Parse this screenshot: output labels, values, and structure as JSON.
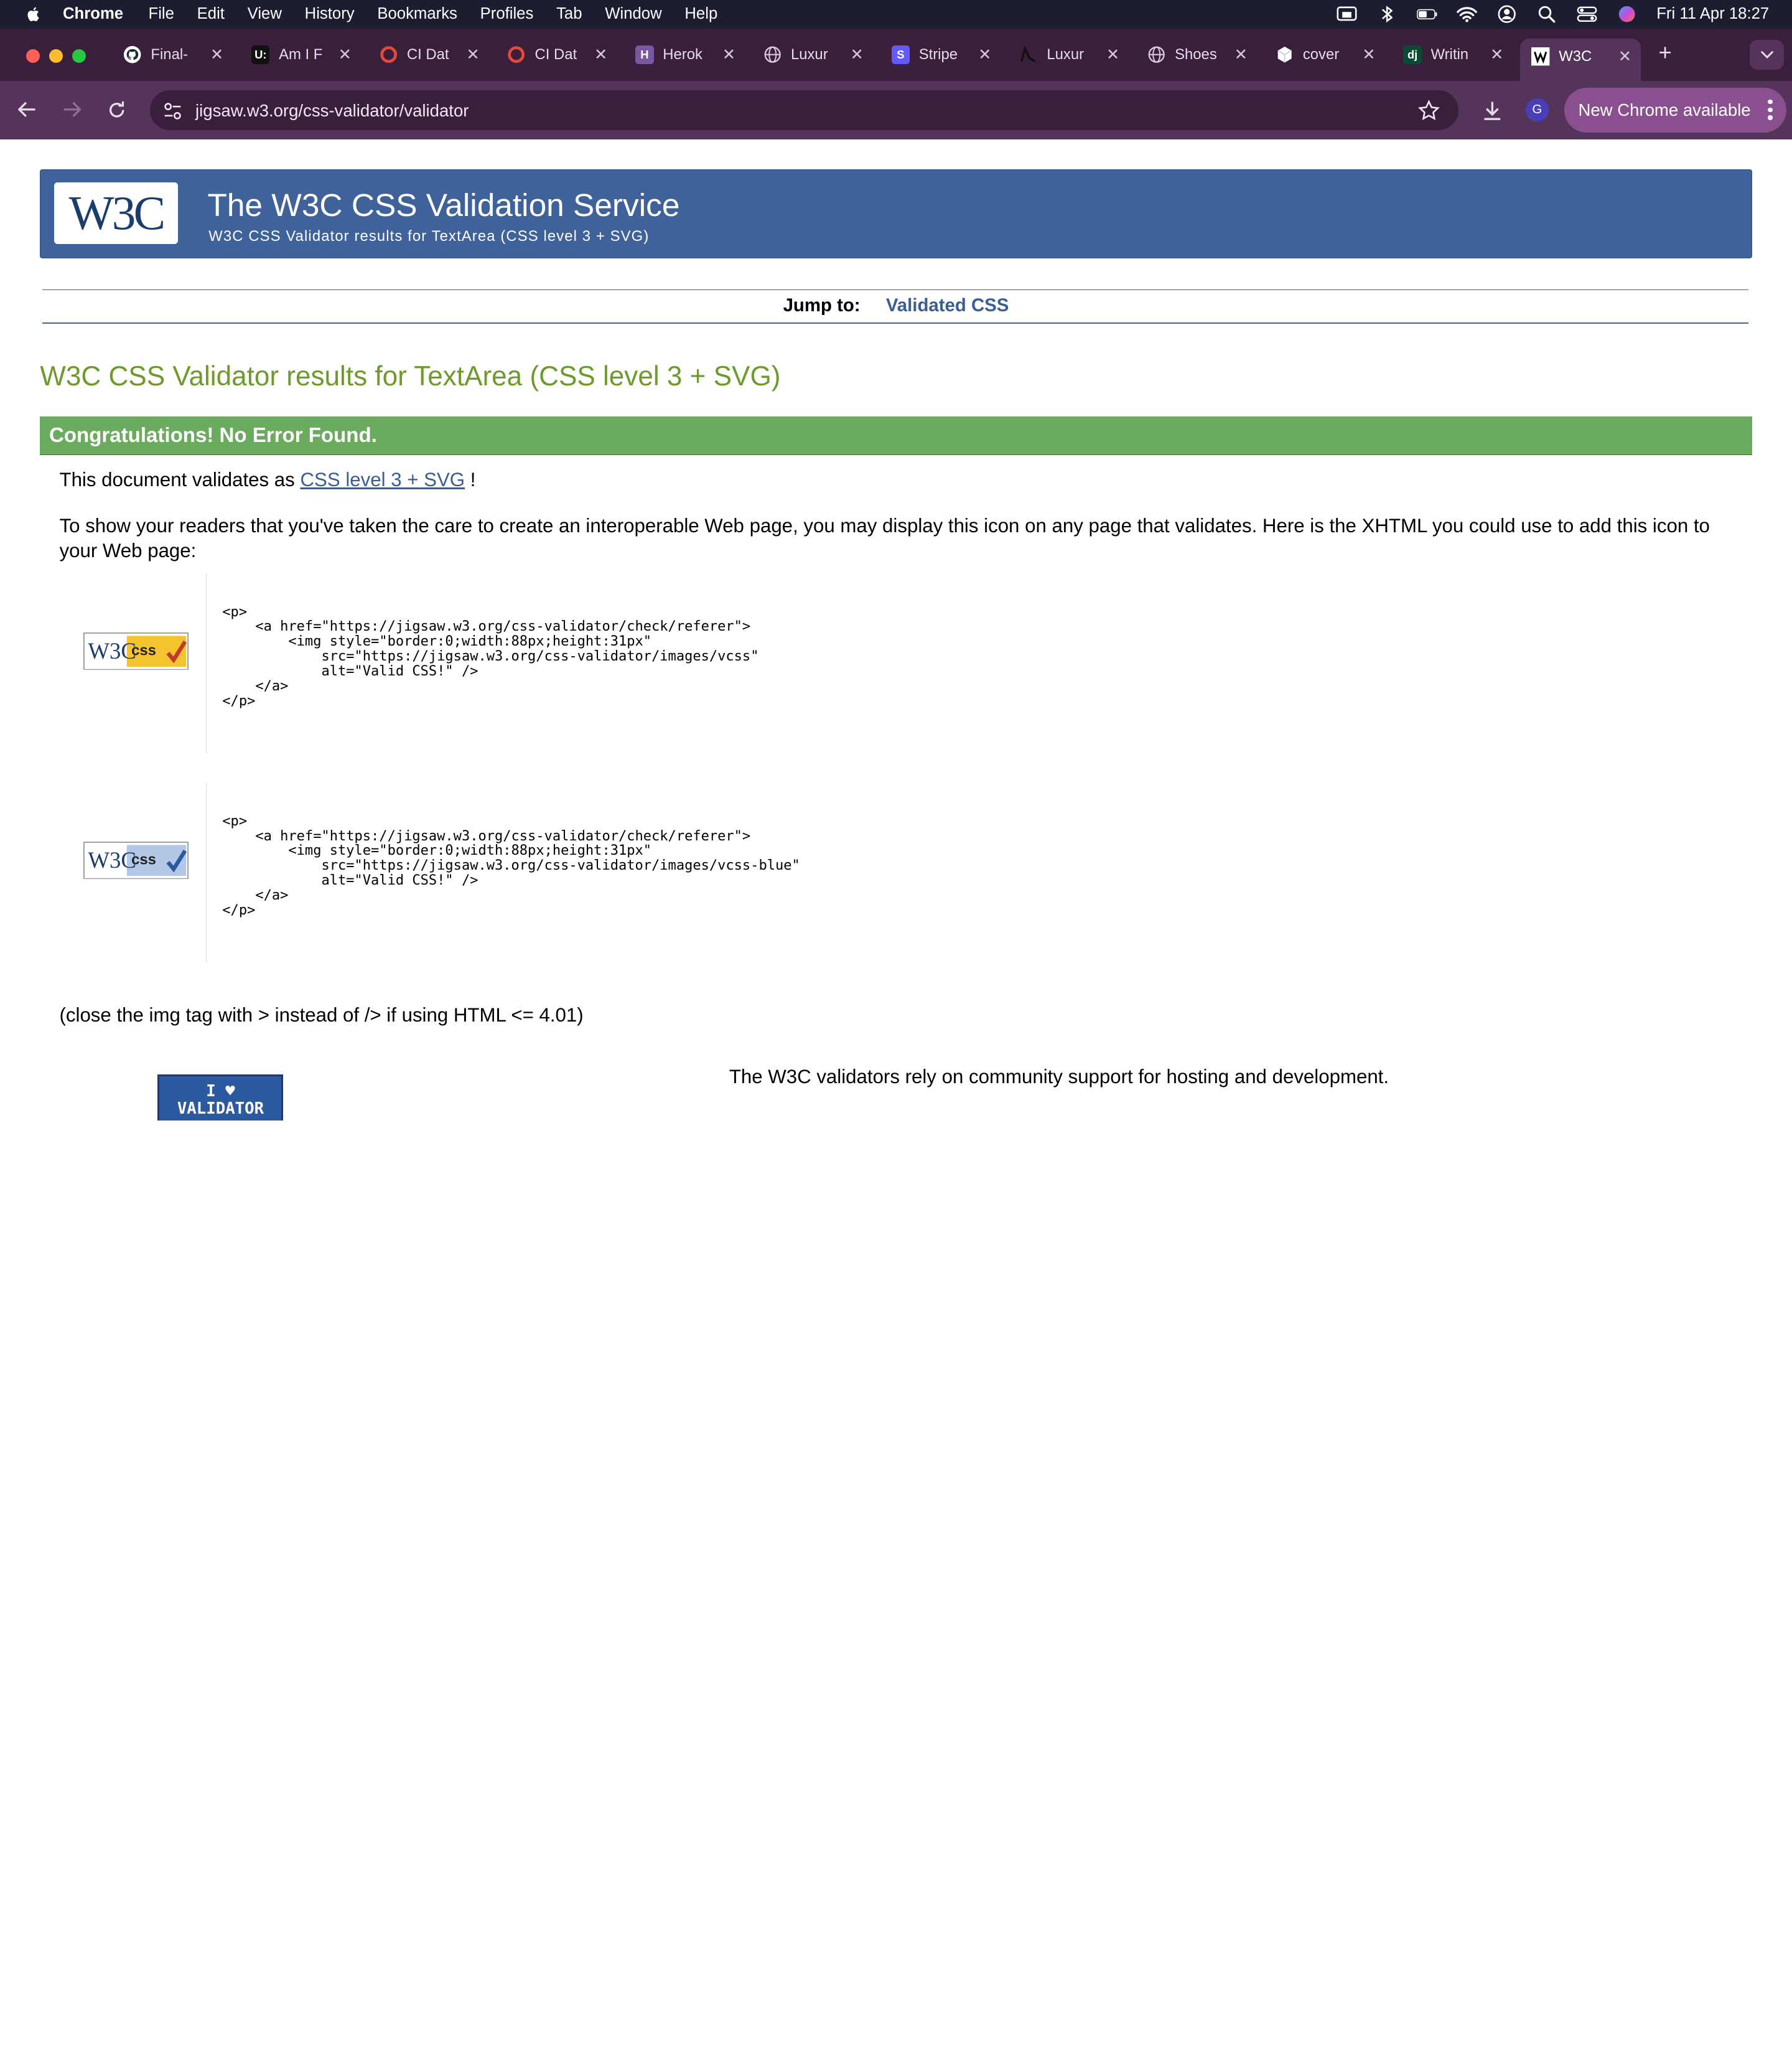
{
  "menubar": {
    "app": "Chrome",
    "items": [
      "File",
      "Edit",
      "View",
      "History",
      "Bookmarks",
      "Profiles",
      "Tab",
      "Window",
      "Help"
    ],
    "clock": "Fri 11 Apr  18:27"
  },
  "tabs": [
    {
      "title": "Final-",
      "icon": "github-icon"
    },
    {
      "title": "Am I F",
      "icon": "ui-icon",
      "icon_text": "U:"
    },
    {
      "title": "CI Dat",
      "icon": "ci-icon"
    },
    {
      "title": "CI Dat",
      "icon": "ci-icon"
    },
    {
      "title": "Herok",
      "icon": "heroku-icon",
      "icon_text": "H"
    },
    {
      "title": "Luxur",
      "icon": "globe-icon"
    },
    {
      "title": "Stripe",
      "icon": "stripe-icon",
      "icon_text": "S"
    },
    {
      "title": "Luxur",
      "icon": "luxury-icon"
    },
    {
      "title": "Shoes",
      "icon": "globe-icon"
    },
    {
      "title": "cover",
      "icon": "cube-icon"
    },
    {
      "title": "Writin",
      "icon": "django-icon",
      "icon_text": "dj"
    },
    {
      "title": "W3C",
      "icon": "w3c-icon"
    }
  ],
  "toolbar": {
    "url": "jigsaw.w3.org/css-validator/validator",
    "profile_initial": "G",
    "update_label": "New Chrome available"
  },
  "page": {
    "logo_text": "W3C",
    "title": "The W3C CSS Validation Service",
    "subtitle": "W3C CSS Validator results for TextArea (CSS level 3 + SVG)",
    "jump_label": "Jump to:",
    "jump_link": "Validated CSS",
    "results_title": "W3C CSS Validator results for TextArea (CSS level 3 + SVG)",
    "congrats": "Congratulations! No Error Found.",
    "validates_prefix": "This document validates as ",
    "validates_link": "CSS level 3 + SVG",
    "validates_suffix": " !",
    "show_readers": "To show your readers that you've taken the care to create an interoperable Web page, you may display this icon on any page that validates. Here is the XHTML you could use to add this icon to your Web page:",
    "code1": "<p>\n    <a href=\"https://jigsaw.w3.org/css-validator/check/referer\">\n        <img style=\"border:0;width:88px;height:31px\"\n            src=\"https://jigsaw.w3.org/css-validator/images/vcss\"\n            alt=\"Valid CSS!\" />\n    </a>\n</p>",
    "code2": "<p>\n    <a href=\"https://jigsaw.w3.org/css-validator/check/referer\">\n        <img style=\"border:0;width:88px;height:31px\"\n            src=\"https://jigsaw.w3.org/css-validator/images/vcss-blue\"\n            alt=\"Valid CSS!\" />\n    </a>\n</p>",
    "badge_w3c": "W3C",
    "badge_css": "css",
    "close_note": "(close the img tag with > instead of /> if using HTML <= 4.01)",
    "validator_badge_line1": "I ♥",
    "validator_badge_line2": "VALIDATOR",
    "footer": "The W3C validators rely on community support for hosting and development."
  }
}
